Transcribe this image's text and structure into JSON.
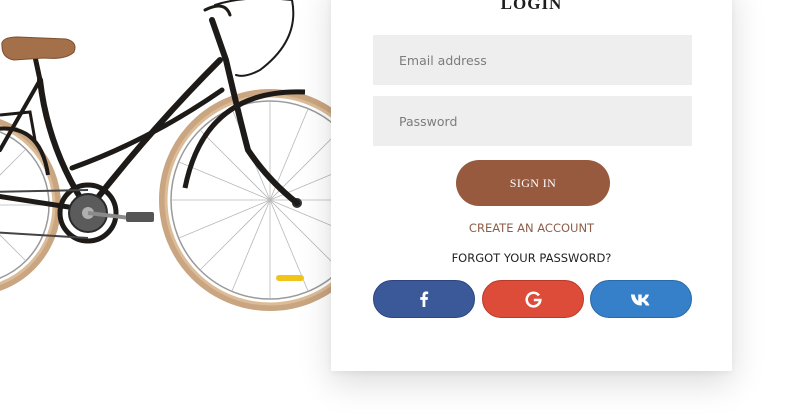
{
  "login": {
    "title": "LOGIN",
    "email_placeholder": "Email address",
    "password_placeholder": "Password",
    "signin_label": "SIGN IN",
    "create_account_label": "CREATE AN ACCOUNT",
    "forgot_password_label": "FORGOT YOUR PASSWORD?"
  },
  "social": [
    {
      "name": "facebook",
      "icon": "facebook-icon",
      "color": "#3b5999"
    },
    {
      "name": "google",
      "icon": "google-icon",
      "color": "#dd4b39"
    },
    {
      "name": "vk",
      "icon": "vk-icon",
      "color": "#3580c8"
    }
  ],
  "colors": {
    "accent": "#975a3f",
    "link": "#8d5d47",
    "field_background": "#eeeeee",
    "bike_rim": "#d9b690",
    "bike_frame": "#1d1a17",
    "saddle": "#a4704a"
  },
  "images": {
    "bicycle": "bicycle-illustration"
  }
}
